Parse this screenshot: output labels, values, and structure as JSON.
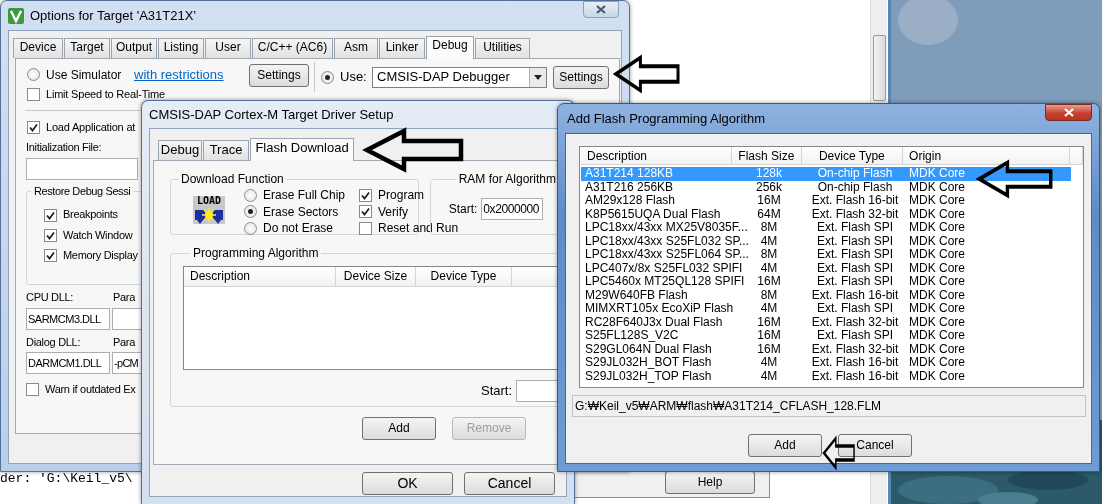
{
  "options_window": {
    "title": "Options for Target 'A31T21X'",
    "tabs": [
      {
        "label": "Device",
        "selected": false
      },
      {
        "label": "Target",
        "selected": false
      },
      {
        "label": "Output",
        "selected": false
      },
      {
        "label": "Listing",
        "selected": false
      },
      {
        "label": "User",
        "selected": false
      },
      {
        "label": "C/C++ (AC6)",
        "selected": false
      },
      {
        "label": "Asm",
        "selected": false
      },
      {
        "label": "Linker",
        "selected": false
      },
      {
        "label": "Debug",
        "selected": true
      },
      {
        "label": "Utilities",
        "selected": false
      }
    ],
    "simulator": {
      "label": "Use Simulator",
      "selected": false
    },
    "restrictions_link": "with restrictions",
    "simulator_settings_button": "Settings",
    "debugger": {
      "label": "Use:",
      "selected": true
    },
    "debugger_select": "CMSIS-DAP Debugger",
    "debugger_settings_button": "Settings",
    "limit_speed": {
      "label": "Limit Speed to Real-Time",
      "checked": false
    },
    "load_application": {
      "label": "Load Application at",
      "checked": true
    },
    "initialization_file_label": "Initialization File:",
    "restore_group": {
      "title": "Restore Debug Sessi",
      "items": [
        {
          "label": "Breakpoints",
          "checked": true
        },
        {
          "label": "Watch Window",
          "checked": true
        },
        {
          "label": "Memory Display",
          "checked": true
        }
      ]
    },
    "dll_rows": [
      {
        "label": "CPU DLL:",
        "value": "SARMCM3.DLL",
        "parameter_label": "Para"
      },
      {
        "label": "Dialog DLL:",
        "value": "DARMCM1.DLL",
        "parameter_label": "Para",
        "parameter_value": "-pCM"
      }
    ],
    "warn_outdated": {
      "label": "Warn if outdated Ex",
      "checked": false
    }
  },
  "driver_window": {
    "title": "CMSIS-DAP Cortex-M Target Driver Setup",
    "tabs": [
      {
        "label": "Debug",
        "selected": false
      },
      {
        "label": "Trace",
        "selected": false
      },
      {
        "label": "Flash Download",
        "selected": true
      }
    ],
    "download_function": {
      "title": "Download Function",
      "icon_text": "LOAD",
      "erase_options": [
        {
          "label": "Erase Full Chip",
          "selected": false
        },
        {
          "label": "Erase Sectors",
          "selected": true
        },
        {
          "label": "Do not Erase",
          "selected": false
        }
      ],
      "actions": [
        {
          "label": "Program",
          "checked": true
        },
        {
          "label": "Verify",
          "checked": true
        },
        {
          "label": "Reset and Run",
          "checked": false
        }
      ]
    },
    "ram_for_algorithm": {
      "title": "RAM for Algorithm",
      "start_label": "Start:",
      "start_value": "0x2000000"
    },
    "programming_algorithm": {
      "title": "Programming Algorithm",
      "columns": [
        "Description",
        "Device Size",
        "Device Type"
      ],
      "start_label": "Start:"
    },
    "buttons": [
      {
        "label": "Add",
        "disabled": false
      },
      {
        "label": "Remove",
        "disabled": true
      }
    ],
    "dialog_buttons": [
      "OK",
      "Cancel"
    ]
  },
  "algorithm_window": {
    "title": "Add Flash Programming Algorithm",
    "columns": [
      "Description",
      "Flash Size",
      "Device Type",
      "Origin"
    ],
    "rows": [
      {
        "description": "A31T214 128KB",
        "flash_size": "128k",
        "device_type": "On-chip Flash",
        "origin": "MDK Core",
        "selected": true
      },
      {
        "description": "A31T216 256KB",
        "flash_size": "256k",
        "device_type": "On-chip Flash",
        "origin": "MDK Core",
        "selected": false
      },
      {
        "description": "AM29x128 Flash",
        "flash_size": "16M",
        "device_type": "Ext. Flash 16-bit",
        "origin": "MDK Core",
        "selected": false
      },
      {
        "description": "K8P5615UQA Dual Flash",
        "flash_size": "64M",
        "device_type": "Ext. Flash 32-bit",
        "origin": "MDK Core",
        "selected": false
      },
      {
        "description": "LPC18xx/43xx MX25V8035F...",
        "flash_size": "8M",
        "device_type": "Ext. Flash SPI",
        "origin": "MDK Core",
        "selected": false
      },
      {
        "description": "LPC18xx/43xx S25FL032 SP...",
        "flash_size": "4M",
        "device_type": "Ext. Flash SPI",
        "origin": "MDK Core",
        "selected": false
      },
      {
        "description": "LPC18xx/43xx S25FL064 SP...",
        "flash_size": "8M",
        "device_type": "Ext. Flash SPI",
        "origin": "MDK Core",
        "selected": false
      },
      {
        "description": "LPC407x/8x S25FL032 SPIFI",
        "flash_size": "4M",
        "device_type": "Ext. Flash SPI",
        "origin": "MDK Core",
        "selected": false
      },
      {
        "description": "LPC5460x MT25QL128 SPIFI",
        "flash_size": "16M",
        "device_type": "Ext. Flash SPI",
        "origin": "MDK Core",
        "selected": false
      },
      {
        "description": "M29W640FB Flash",
        "flash_size": "8M",
        "device_type": "Ext. Flash 16-bit",
        "origin": "MDK Core",
        "selected": false
      },
      {
        "description": "MIMXRT105x EcoXiP Flash",
        "flash_size": "4M",
        "device_type": "Ext. Flash SPI",
        "origin": "MDK Core",
        "selected": false
      },
      {
        "description": "RC28F640J3x Dual Flash",
        "flash_size": "16M",
        "device_type": "Ext. Flash 32-bit",
        "origin": "MDK Core",
        "selected": false
      },
      {
        "description": "S25FL128S_V2C",
        "flash_size": "16M",
        "device_type": "Ext. Flash SPI",
        "origin": "MDK Core",
        "selected": false
      },
      {
        "description": "S29GL064N Dual Flash",
        "flash_size": "16M",
        "device_type": "Ext. Flash 32-bit",
        "origin": "MDK Core",
        "selected": false
      },
      {
        "description": "S29JL032H_BOT Flash",
        "flash_size": "4M",
        "device_type": "Ext. Flash 16-bit",
        "origin": "MDK Core",
        "selected": false
      },
      {
        "description": "S29JL032H_TOP Flash",
        "flash_size": "4M",
        "device_type": "Ext. Flash 16-bit",
        "origin": "MDK Core",
        "selected": false
      }
    ],
    "path": "G:₩Keil_v5₩ARM₩flash₩A31T214_CFLASH_128.FLM",
    "buttons": [
      "Add",
      "Cancel"
    ]
  },
  "background": {
    "output_text": "der: 'G:\\Keil_v5\\",
    "help_button": "Help"
  }
}
